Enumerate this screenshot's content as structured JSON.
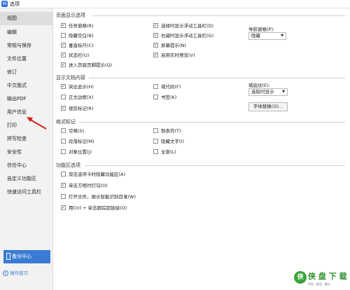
{
  "window": {
    "title": "选项",
    "icon": "app-logo-icon"
  },
  "sidebar": {
    "items": [
      {
        "label": "视图",
        "selected": true
      },
      {
        "label": "编辑"
      },
      {
        "label": "常规与保存"
      },
      {
        "label": "文件位置"
      },
      {
        "label": "修订"
      },
      {
        "label": "中文版式"
      },
      {
        "label": "输出PDF"
      },
      {
        "label": "用户信息"
      },
      {
        "label": "打印"
      },
      {
        "label": "拼写检查"
      },
      {
        "label": "安全性"
      },
      {
        "label": "信任中心"
      },
      {
        "label": "自定义功能区"
      },
      {
        "label": "快速访问工具栏"
      }
    ],
    "backup_label": "备份中心",
    "tips_label": "操作技巧"
  },
  "page_display": {
    "title": "页面显示选项",
    "left": [
      {
        "label": "任务窗格(R)",
        "checked": true
      },
      {
        "label": "隐藏空白(B)",
        "checked": false
      },
      {
        "label": "垂直标尺(C)",
        "checked": true
      },
      {
        "label": "状态栏(U)",
        "checked": true
      },
      {
        "label": "进入页眉页脚提示(Q)",
        "checked": true
      }
    ],
    "right": [
      {
        "label": "选择时显示浮动工具栏(D)",
        "checked": true
      },
      {
        "label": "右键时显示浮动工具栏(G)",
        "checked": true
      },
      {
        "label": "屏幕提示(N)",
        "checked": true
      },
      {
        "label": "启用实时预览(V)",
        "checked": true
      }
    ],
    "nav_label": "导航窗格(P):",
    "nav_value": "隐藏"
  },
  "doc_content": {
    "title": "显示文档内容",
    "left": [
      {
        "label": "突出显示(H)",
        "checked": true
      },
      {
        "label": "正文边框(X)",
        "checked": false
      },
      {
        "label": "裁剪标记(R)",
        "checked": true
      }
    ],
    "right": [
      {
        "label": "域代码(F)",
        "checked": false
      },
      {
        "label": "书签(K)",
        "checked": false
      }
    ],
    "field_label": "域底纹(E):",
    "field_value": "选取时显示",
    "font_button": "字体替换(O)..."
  },
  "format_marks": {
    "title": "格式标记",
    "left": [
      {
        "label": "空格(S)",
        "checked": false
      },
      {
        "label": "段落标记(M)",
        "checked": false
      },
      {
        "label": "对象位置(J)",
        "checked": false
      }
    ],
    "right": [
      {
        "label": "制表符(T)",
        "checked": false
      },
      {
        "label": "隐藏文字(I)",
        "checked": false
      },
      {
        "label": "全部(L)",
        "checked": false
      }
    ]
  },
  "ribbon": {
    "title": "功能区选项",
    "items": [
      {
        "label": "双击选项卡时隐藏功能区(A)",
        "checked": false
      },
      {
        "label": "单击方框时打勾(O)",
        "checked": true
      },
      {
        "label": "打开文件，展示智能识别目录(W)",
        "checked": false
      },
      {
        "label": "用Ctrl + 单击跟踪超链接(O)",
        "checked": true
      }
    ]
  },
  "watermark": {
    "logo": "侠",
    "text": "侠 盘 下 载",
    "sub": "平台 · 安全 · 放心"
  },
  "icons": {
    "check": "check-icon",
    "caret": "chevron-down-icon",
    "backup": "backup-icon",
    "tips": "tips-icon"
  }
}
